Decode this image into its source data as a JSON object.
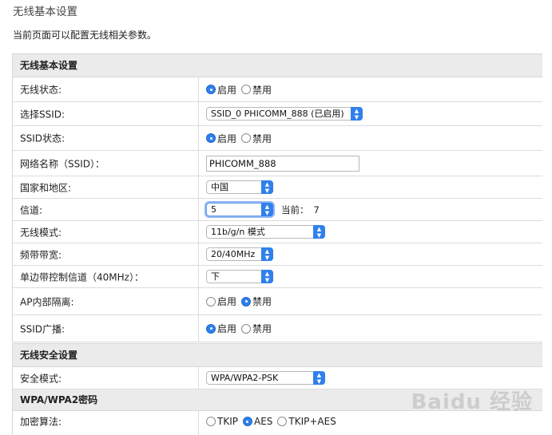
{
  "page": {
    "heading": "无线基本设置",
    "description": "当前页面可以配置无线相关参数。"
  },
  "basic": {
    "title": "无线基本设置",
    "wireless_status": {
      "label": "无线状态:",
      "options": [
        "启用",
        "禁用"
      ],
      "selected": "启用"
    },
    "select_ssid": {
      "label": "选择SSID:",
      "value": "SSID_0 PHICOMM_888 (已启用)"
    },
    "ssid_status": {
      "label": "SSID状态:",
      "options": [
        "启用",
        "禁用"
      ],
      "selected": "启用"
    },
    "network_name": {
      "label": "网络名称（SSID）：",
      "value": "PHICOMM_888"
    },
    "country": {
      "label": "国家和地区:",
      "value": "中国"
    },
    "channel": {
      "label": "信道:",
      "value": "5",
      "current_label": "当前：",
      "current_value": "7"
    },
    "wireless_mode": {
      "label": "无线模式:",
      "value": "11b/g/n 模式"
    },
    "bandwidth": {
      "label": "频带带宽:",
      "value": "20/40MHz"
    },
    "sideband": {
      "label": "单边带控制信道（40MHz）：",
      "value": "下"
    },
    "ap_isolation": {
      "label": "AP内部隔离:",
      "options": [
        "启用",
        "禁用"
      ],
      "selected": "禁用"
    },
    "ssid_broadcast": {
      "label": "SSID广播:",
      "options": [
        "启用",
        "禁用"
      ],
      "selected": "启用"
    }
  },
  "security": {
    "title": "无线安全设置",
    "mode": {
      "label": "安全模式:",
      "value": "WPA/WPA2-PSK"
    },
    "wpa_section_title": "WPA/WPA2密码",
    "encryption": {
      "label": "加密算法:",
      "options": [
        "TKIP",
        "AES",
        "TKIP+AES"
      ],
      "selected": "AES"
    }
  },
  "watermark": "Baidu 经验",
  "colors": {
    "accent": "#2f80ed",
    "panel_header": "#ebebeb",
    "border": "#dcdcdc"
  }
}
